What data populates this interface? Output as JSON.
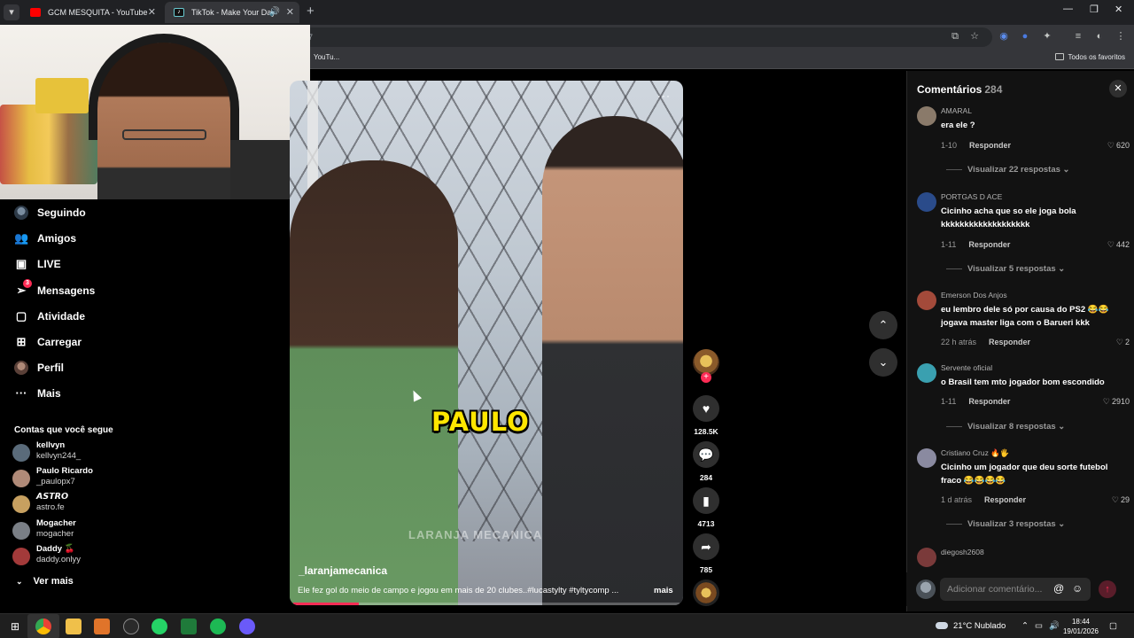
{
  "browser": {
    "tabs": [
      {
        "title": "GCM MESQUITA - YouTube",
        "favicon": "youtube-icon"
      },
      {
        "title": "TikTok - Make Your Day",
        "favicon": "tiktok-icon",
        "active": true
      }
    ],
    "address_fragment": "7",
    "bookmark_item": "YouTu...",
    "all_bookmarks": "Todos os favoritos"
  },
  "sidebar": {
    "items": [
      {
        "label": "Seguindo",
        "icon": "following-avatar-icon"
      },
      {
        "label": "Amigos",
        "icon": "friends-icon"
      },
      {
        "label": "LIVE",
        "icon": "live-icon"
      },
      {
        "label": "Mensagens",
        "icon": "messages-icon",
        "badge": "3"
      },
      {
        "label": "Atividade",
        "icon": "activity-icon"
      },
      {
        "label": "Carregar",
        "icon": "upload-icon"
      },
      {
        "label": "Perfil",
        "icon": "profile-avatar-icon"
      },
      {
        "label": "Mais",
        "icon": "more-dots-icon"
      }
    ],
    "following_title": "Contas que você segue",
    "following": [
      {
        "name": "kellvyn",
        "handle": "kellvyn244_",
        "color": "#5a6b7a"
      },
      {
        "name": "Paulo Ricardo",
        "handle": "_paulopx7",
        "color": "#b08a78"
      },
      {
        "name": "𝘼𝙎𝙏𝙍𝙊",
        "handle": "astro.fe",
        "color": "#c7a060"
      },
      {
        "name": "Mogacher",
        "handle": "mogacher",
        "color": "#7a7f86"
      },
      {
        "name": "Daddy 🍒",
        "handle": "daddy.onlyy",
        "color": "#a33a3a"
      }
    ],
    "see_more": "Ver mais"
  },
  "video": {
    "overlay_text": "PAULO",
    "watermark": "LARANJA MECANICA",
    "author": "_laranjamecanica",
    "caption": "Ele fez gol do meio de campo e jogou em mais de 20 clubes..#lucastylty #tyltycomp ...",
    "caption_more": "mais",
    "progress": 0.17
  },
  "actions": {
    "likes": "128.5K",
    "comments": "284",
    "saves": "4713",
    "shares": "785"
  },
  "comments": {
    "title": "Comentários",
    "count": "284",
    "input_placeholder": "Adicionar comentário...",
    "items": [
      {
        "user": "AMARAL",
        "text": "era ele ?",
        "time": "1-10",
        "reply": "Responder",
        "likes": "620",
        "view_replies": "Visualizar 22 respostas",
        "avatar": "#8a7a6a"
      },
      {
        "user": "PORTGAS D ACE",
        "text": "Cicinho acha que so ele joga bola kkkkkkkkkkkkkkkkkkk",
        "time": "1-11",
        "reply": "Responder",
        "likes": "442",
        "view_replies": "Visualizar 5 respostas",
        "avatar": "#2a4b8a"
      },
      {
        "user": "Emerson Dos Anjos",
        "text": "eu lembro dele só por causa do PS2 😂😂 jogava master liga com o Barueri kkk",
        "time": "22 h atrás",
        "reply": "Responder",
        "likes": "2",
        "view_replies": "",
        "avatar": "#a34a3a"
      },
      {
        "user": "Servente oficial",
        "text": "o Brasil tem mto jogador bom escondido",
        "time": "1-11",
        "reply": "Responder",
        "likes": "2910",
        "view_replies": "Visualizar 8 respostas",
        "avatar": "#3aa0b0"
      },
      {
        "user": "Cristiano Cruz 🔥🖐",
        "text": "Cicinho um jogador que deu sorte futebol fraco 😂😂😂😂",
        "time": "1 d atrás",
        "reply": "Responder",
        "likes": "29",
        "view_replies": "Visualizar 3 respostas",
        "avatar": "#8a8aa0"
      },
      {
        "user": "diegosh2608",
        "text": "",
        "time": "",
        "reply": "",
        "likes": "",
        "view_replies": "",
        "avatar": "#7a3a3a"
      }
    ]
  },
  "taskbar": {
    "weather": "21°C  Nublado",
    "time": "18:44",
    "date": "19/01/2026"
  }
}
